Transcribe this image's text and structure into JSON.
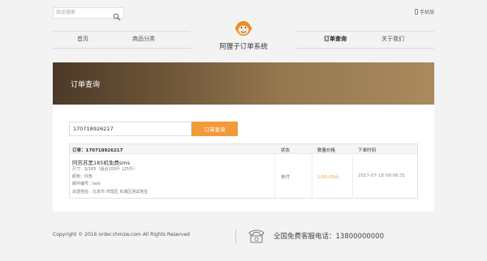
{
  "header": {
    "search_placeholder": "商品搜索",
    "mobile_label": "手机版"
  },
  "nav": {
    "items": [
      "首页",
      "商品分类",
      "订单查询",
      "关于我们"
    ],
    "active_index": 2
  },
  "logo": {
    "text": "阿狸子订单系统"
  },
  "banner": {
    "title": "订单查询"
  },
  "query": {
    "input_value": "170718926217",
    "button_label": "订单查询"
  },
  "order": {
    "id_label": "订单：170718926217",
    "col_status": "状态",
    "col_price": "数量价格",
    "col_time": "下单时间",
    "product": "阿苏苏黑185机免费sms",
    "spec": "尺寸：S/165（适合100斤 125斤）",
    "color": "颜色：红色",
    "code": "邮件编号：test",
    "address": "派送地址：北京市 市辖区 东城区测试地址",
    "status": "未付",
    "price": "1/50.00元",
    "time": "2017-07-18 09:06:31"
  },
  "footer": {
    "copyright": "Copyright © 2016 order.chmzw.com All Rights Reserved",
    "hotline": "全国免费客服电话：13800000000"
  },
  "colors": {
    "accent": "#f39a3a",
    "banner_dark": "#4b3a27",
    "banner_light": "#aa8a5e"
  },
  "icons": [
    "search-icon",
    "mobile-icon",
    "monkey-logo-icon",
    "telephone-icon"
  ]
}
